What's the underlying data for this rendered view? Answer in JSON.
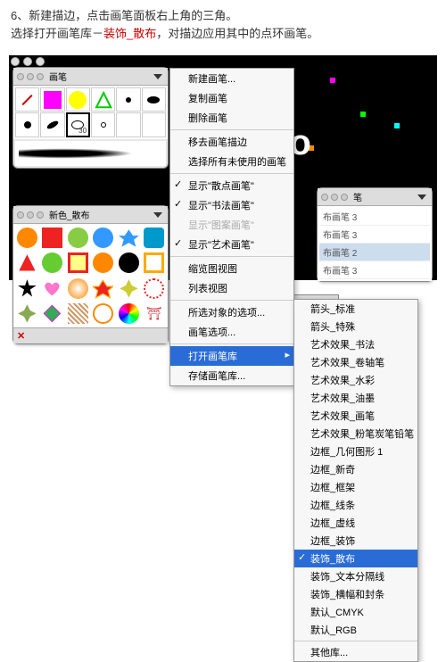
{
  "instructions": {
    "line1a": "6、新建描边，点击画笔面板右上角的三角。",
    "line2a": "选择打开画笔库－",
    "line2b": "装饰_散布",
    "line2c": "，对描边应用其中的点环画笔。"
  },
  "brush_panel": {
    "title": "画笔",
    "stroke_size": "30"
  },
  "swatch_panel": {
    "title": "新色_散布"
  },
  "right_panel": {
    "rows": [
      "布画笔 3",
      "布画笔 3",
      "布画笔 2",
      "布画笔 3"
    ]
  },
  "menu": {
    "items": [
      {
        "label": "新建画笔...",
        "type": "item"
      },
      {
        "label": "复制画笔",
        "type": "item"
      },
      {
        "label": "删除画笔",
        "type": "item"
      },
      {
        "type": "sep"
      },
      {
        "label": "移去画笔描边",
        "type": "item"
      },
      {
        "label": "选择所有未使用的画笔",
        "type": "item"
      },
      {
        "type": "sep"
      },
      {
        "label": "显示\"散点画笔\"",
        "type": "check"
      },
      {
        "label": "显示\"书法画笔\"",
        "type": "check"
      },
      {
        "label": "显示\"图案画笔\"",
        "type": "disabled"
      },
      {
        "label": "显示\"艺术画笔\"",
        "type": "check"
      },
      {
        "type": "sep"
      },
      {
        "label": "缩览图视图",
        "type": "item"
      },
      {
        "label": "列表视图",
        "type": "item"
      },
      {
        "type": "sep"
      },
      {
        "label": "所选对象的选项...",
        "type": "item"
      },
      {
        "label": "画笔选项...",
        "type": "item"
      },
      {
        "type": "sep"
      },
      {
        "label": "打开画笔库",
        "type": "sel sub"
      },
      {
        "label": "存储画笔库...",
        "type": "item"
      }
    ]
  },
  "submenu": {
    "items": [
      "箭头_标准",
      "箭头_特殊",
      "艺术效果_书法",
      "艺术效果_卷轴笔",
      "艺术效果_水彩",
      "艺术效果_油墨",
      "艺术效果_画笔",
      "艺术效果_粉笔炭笔铅笔",
      "边框_几何图形 1",
      "边框_新奇",
      "边框_框架",
      "边框_线条",
      "边框_虚线",
      "边框_装饰"
    ],
    "selected": "装饰_散布",
    "after": [
      "装饰_文本分隔线",
      "装饰_横幅和封条",
      "默认_CMYK",
      "默认_RGB"
    ],
    "footer": "其他库..."
  }
}
